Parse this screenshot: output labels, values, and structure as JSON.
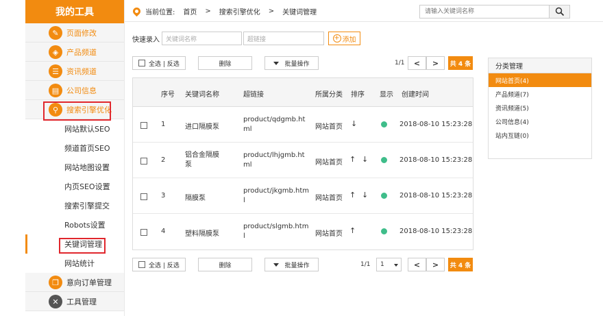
{
  "sidebar": {
    "title": "我的工具",
    "items": [
      {
        "label": "页面修改",
        "icon": "pencil-icon",
        "glyph": "✎"
      },
      {
        "label": "产品频道",
        "icon": "box-icon",
        "glyph": "◈"
      },
      {
        "label": "资讯频道",
        "icon": "document-icon",
        "glyph": "☰"
      },
      {
        "label": "公司信息",
        "icon": "id-card-icon",
        "glyph": "▤"
      },
      {
        "label": "搜索引擎优化",
        "icon": "search-icon",
        "glyph": "⚲"
      }
    ],
    "subitems": [
      "网站默认SEO",
      "频道首页SEO",
      "网站地图设置",
      "内页SEO设置",
      "搜索引擎提交",
      "Robots设置",
      "关键词管理",
      "网站统计"
    ],
    "bottom_items": [
      {
        "label": "意向订单管理",
        "icon": "order-icon",
        "glyph": "❐"
      },
      {
        "label": "工具管理",
        "icon": "wrench-icon",
        "glyph": "✕"
      }
    ]
  },
  "breadcrumb": {
    "prefix": "当前位置:",
    "home": "首页",
    "sep": ">",
    "level1": "搜索引擎优化",
    "level2": "关键词管理"
  },
  "search": {
    "placeholder": "请输入关键词名称"
  },
  "quick": {
    "label": "快速录入",
    "name_placeholder": "关键词名称",
    "link_placeholder": "超链接",
    "add_label": "添加",
    "add_glyph": "+"
  },
  "toolbar": {
    "select_all": "全选 | 反选",
    "delete": "删除",
    "batch": "批量操作",
    "page_info": "1/1",
    "prev": "<",
    "next": ">",
    "total": "共 4 条",
    "page_select": "1"
  },
  "table": {
    "headers": [
      "序号",
      "关键词名称",
      "超链接",
      "所属分类",
      "排序",
      "显示",
      "创建时间"
    ],
    "rows": [
      {
        "no": "1",
        "name": "进口隔膜泵",
        "link1": "product/qdgmb.ht",
        "link2": "ml",
        "category": "网站首页",
        "up": "",
        "down": "↓",
        "created": "2018-08-10 15:23:28"
      },
      {
        "no": "2",
        "name1": "铝合金隔膜",
        "name2": "泵",
        "link1": "product/lhjgmb.ht",
        "link2": "ml",
        "category": "网站首页",
        "up": "↑",
        "down": "↓",
        "created": "2018-08-10 15:23:28"
      },
      {
        "no": "3",
        "name": "隔膜泵",
        "link1": "product/jkgmb.htm",
        "link2": "l",
        "category": "网站首页",
        "up": "↑",
        "down": "↓",
        "created": "2018-08-10 15:23:28"
      },
      {
        "no": "4",
        "name": "塑料隔膜泵",
        "link1": "product/slgmb.htm",
        "link2": "l",
        "category": "网站首页",
        "up": "↑",
        "down": "",
        "created": "2018-08-10 15:23:28"
      }
    ]
  },
  "categories": {
    "title": "分类管理",
    "items": [
      "网站首页(4)",
      "产品频道(7)",
      "资讯频道(5)",
      "公司信息(4)",
      "站内互链(0)"
    ]
  },
  "colors": {
    "accent": "#f28b10",
    "highlight_box": "#e0262c",
    "status_green": "#3fbd8a"
  }
}
